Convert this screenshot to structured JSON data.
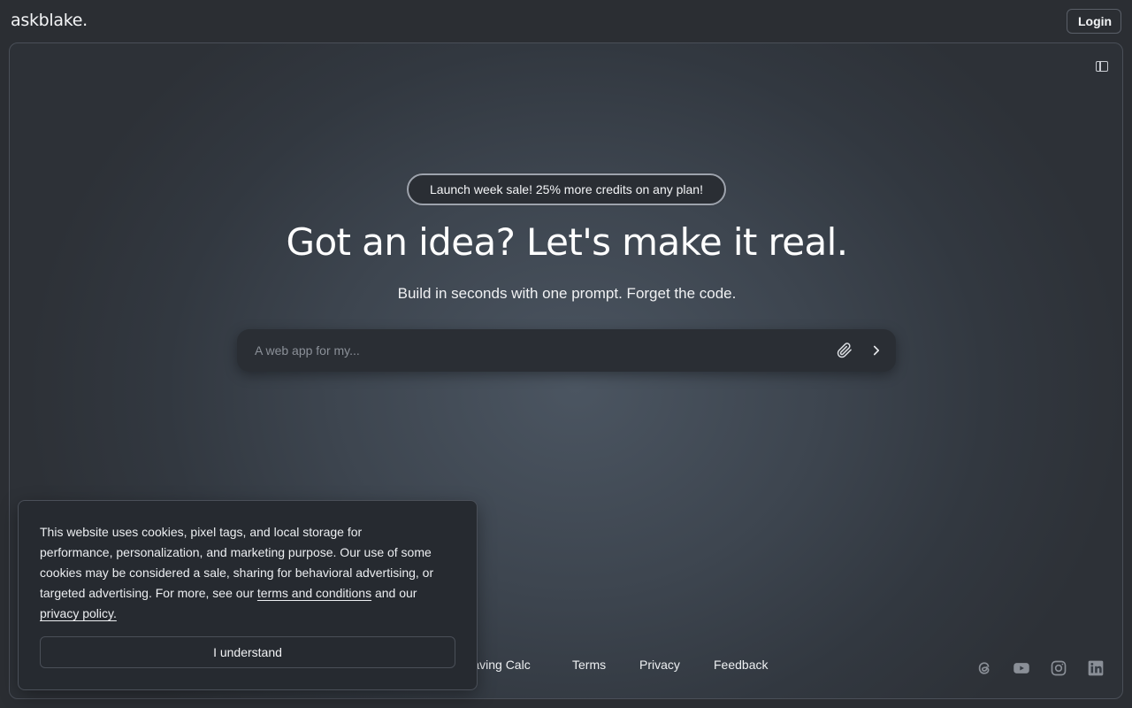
{
  "header": {
    "logo": "askblake.",
    "login_label": "Login"
  },
  "hero": {
    "promo": "Launch week sale! 25% more credits on any plan!",
    "headline": "Got an idea? Let's make it real.",
    "subhead": "Build in seconds with one prompt. Forget the code."
  },
  "prompt": {
    "placeholder": "A web app for my...",
    "attach_icon": "paperclip-icon",
    "send_icon": "chevron-right-icon"
  },
  "footer": {
    "links": [
      "Saving Calc",
      "Terms",
      "Privacy",
      "Feedback"
    ],
    "social": [
      "threads-icon",
      "youtube-icon",
      "instagram-icon",
      "linkedin-icon"
    ]
  },
  "cookie": {
    "text_before": "This website uses cookies, pixel tags, and local storage for performance, personalization, and marketing purpose. Our use of some cookies may be considered a sale, sharing for behavioral advertising, or targeted advertising. For more, see our ",
    "terms_link": "terms and conditions",
    "text_middle": " and our ",
    "privacy_link": "privacy policy.",
    "button_label": "I understand"
  },
  "colors": {
    "background": "#2b2e33",
    "panel": "#262a30",
    "text": "#f2f3f5",
    "muted_icon": "#8a8f97"
  }
}
